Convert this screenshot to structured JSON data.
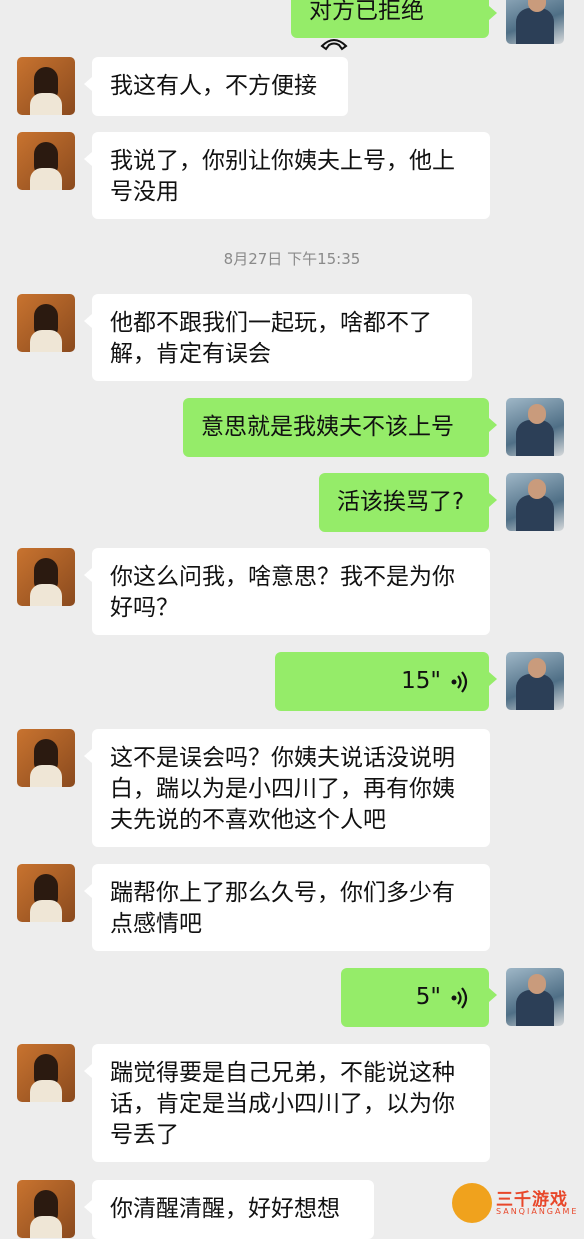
{
  "timestamp": "8月27日 下午15:35",
  "messages": [
    {
      "side": "right",
      "text": "对方已拒绝",
      "type": "call"
    },
    {
      "side": "left",
      "text": "我这有人，不方便接"
    },
    {
      "side": "left",
      "text": "我说了，你别让你姨夫上号，他上号没用"
    },
    {
      "side": "left",
      "text": "他都不跟我们一起玩，啥都不了解，肯定有误会"
    },
    {
      "side": "right",
      "text": "意思就是我姨夫不该上号"
    },
    {
      "side": "right",
      "text": "活该挨骂了?"
    },
    {
      "side": "left",
      "text": "你这么问我，啥意思？我不是为你好吗？"
    },
    {
      "side": "right",
      "text": "15\"",
      "type": "voice"
    },
    {
      "side": "left",
      "text": "这不是误会吗？你姨夫说话没说明白，踹以为是小四川了，再有你姨夫先说的不喜欢他这个人吧"
    },
    {
      "side": "left",
      "text": "踹帮你上了那么久号，你们多少有点感情吧"
    },
    {
      "side": "right",
      "text": "5\"",
      "type": "voice"
    },
    {
      "side": "left",
      "text": "踹觉得要是自己兄弟，不能说这种话，肯定是当成小四川了，以为你号丢了"
    },
    {
      "side": "left",
      "text": "你清醒清醒，好好想想"
    }
  ],
  "watermark": {
    "text": "三千游戏",
    "sub": "SANQIANGAME"
  },
  "icons": {
    "avatar_left": "woman-avatar",
    "avatar_right": "man-avatar",
    "call": "phone-hangup-icon",
    "voice": "voice-wave-icon"
  }
}
